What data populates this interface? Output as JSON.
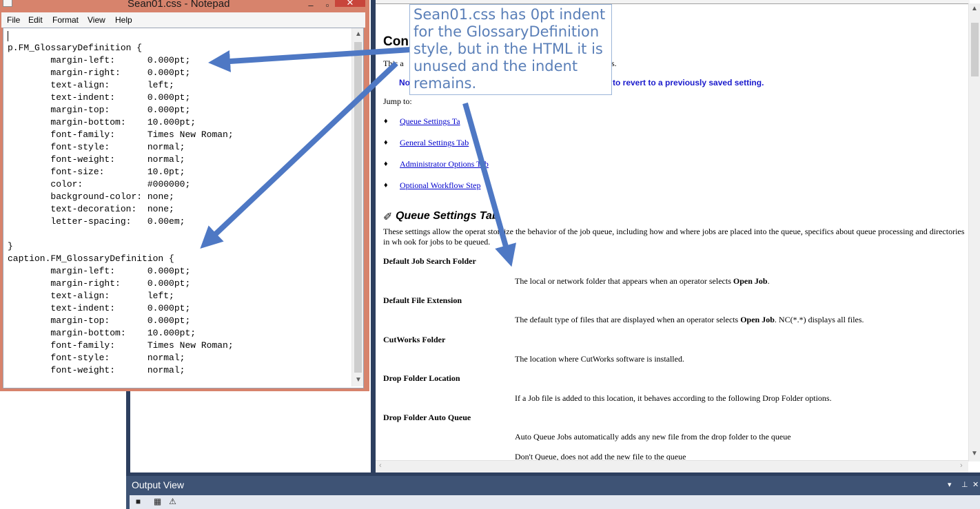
{
  "notepad": {
    "title": "Sean01.css - Notepad",
    "window_buttons": {
      "minimize": "–",
      "maximize": "▫",
      "close": "✕"
    },
    "menu": [
      "File",
      "Edit",
      "Format",
      "View",
      "Help"
    ],
    "code": "p.FM_GlossaryDefinition {\n\tmargin-left:\t  0.000pt;\n\tmargin-right:\t  0.000pt;\n\ttext-align:\t  left;\n\ttext-indent:\t  0.000pt;\n\tmargin-top:\t  0.000pt;\n\tmargin-bottom:\t  10.000pt;\n\tfont-family:\t  Times New Roman;\n\tfont-style:\t  normal;\n\tfont-weight:\t  normal;\n\tfont-size:\t  10.0pt;\n\tcolor:\t\t  #000000;\n\tbackground-color: none;\n\ttext-decoration:  none;\n\tletter-spacing:\t  0.00em;\n\n}\ncaption.FM_GlossaryDefinition {\n\tmargin-left:\t  0.000pt;\n\tmargin-right:\t  0.000pt;\n\ttext-align:\t  left;\n\ttext-indent:\t  0.000pt;\n\tmargin-top:\t  0.000pt;\n\tmargin-bottom:\t  10.000pt;\n\tfont-family:\t  Times New Roman;\n\tfont-style:\t  normal;\n\tfont-weight:\t  normal;"
  },
  "callout": {
    "text": "Sean01.css has 0pt indent for the GlossaryDefinition style, but in the HTML it is unused and the indent remains."
  },
  "help": {
    "heading": "Con",
    "intro_start": "This a",
    "intro_end": "s.",
    "note_start": "No",
    "note_end": "to revert to a previously saved setting.",
    "jump_label": "Jump to:",
    "bullet_glyph": "♦",
    "links": [
      "Queue Settings Ta",
      "General Settings Tab",
      "Administrator Options Tab",
      "Optional Workflow Step"
    ],
    "section_icon": "✐",
    "section_title": "Queue Settings Tab",
    "section_desc": "These settings allow the operat          stomize the behavior of the job queue, including how and where jobs are placed into the queue, specifics about queue processing and directories in wh          ook for jobs to be queued.",
    "terms": [
      {
        "term": "Default Job Search Folder",
        "def_pre": "The local or network folder that appears when an operator selects ",
        "def_bold": "Open Job",
        "def_post": "."
      },
      {
        "term": "Default File Extension",
        "def_pre": "The default type of files that are displayed when an operator selects ",
        "def_bold": "Open Job",
        "def_post": ". NC(*.*) displays all files."
      },
      {
        "term": "CutWorks Folder",
        "def_pre": "The location where CutWorks software is installed.",
        "def_bold": "",
        "def_post": ""
      },
      {
        "term": "Drop Folder Location",
        "def_pre": "If a Job file is added to this location, it behaves according to the following Drop Folder options.",
        "def_bold": "",
        "def_post": ""
      },
      {
        "term": "Drop Folder Auto Queue",
        "def_pre": "Auto Queue Jobs automatically adds any new file from the drop folder to the queue",
        "def_bold": "",
        "def_post": ""
      }
    ],
    "partial_line": "Don't Queue, does not add the new file to the queue"
  },
  "output_view": {
    "title": "Output View",
    "controls": {
      "dropdown": "▾",
      "pin": "⊥",
      "close": "✕"
    },
    "tools": {
      "save": "💾",
      "grid": "▦",
      "warning": "⚠"
    }
  },
  "colors": {
    "notepad_frame": "#d7836c",
    "ide_dark": "#2d3f5f",
    "output_header": "#3e5375",
    "callout_text": "#5a7fb8",
    "arrow": "#4e78c4",
    "link": "#0000cc"
  }
}
